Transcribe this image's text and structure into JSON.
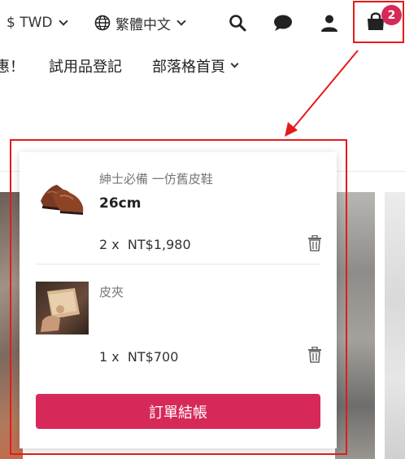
{
  "header": {
    "currency": "$ TWD",
    "language": "繁體中文",
    "cart_count": "2",
    "icons": [
      "search-icon",
      "chat-icon",
      "user-icon",
      "shopping-bag-icon"
    ]
  },
  "nav": {
    "items": [
      {
        "label": "惠！"
      },
      {
        "label": "試用品登記"
      },
      {
        "label": "部落格首頁"
      }
    ]
  },
  "cart": {
    "items": [
      {
        "name": "紳士必備 一仿舊皮鞋",
        "variant": "26cm",
        "quantity": "2 x",
        "price": "NT$1,980"
      },
      {
        "name": "皮夾",
        "variant": "",
        "quantity": "1 x",
        "price": "NT$700"
      }
    ],
    "checkout_label": "訂單結帳"
  },
  "colors": {
    "accent": "#d6295a",
    "annotation": "#e31b1b"
  }
}
